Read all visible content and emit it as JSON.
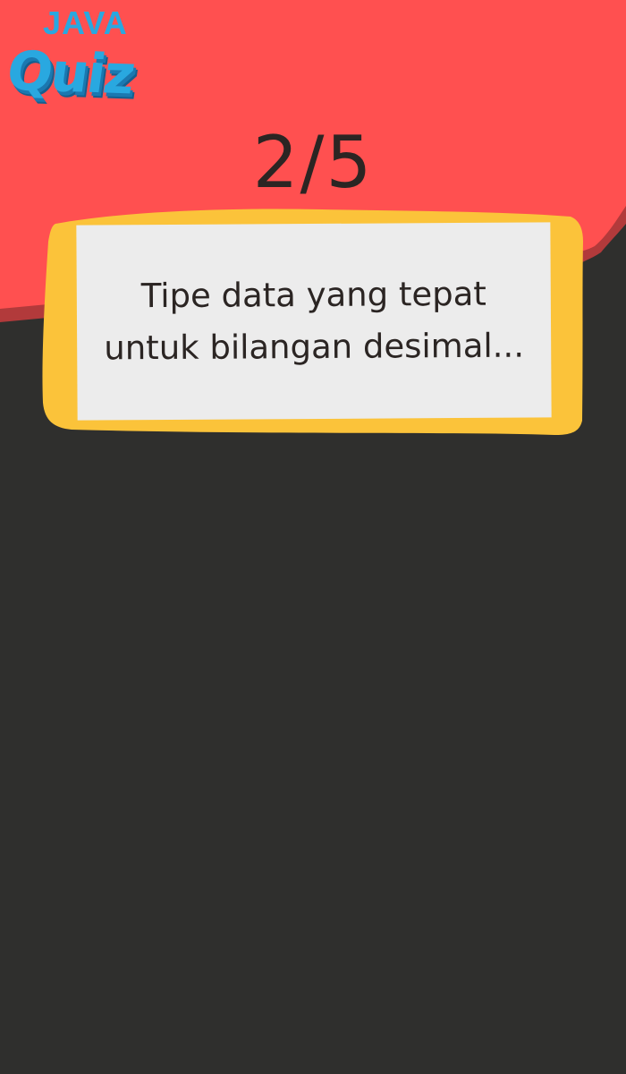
{
  "app": {
    "logo_top": "JAVA",
    "logo_bottom": "Quiz"
  },
  "progress": {
    "text": "2/5",
    "current": 2,
    "total": 5
  },
  "question": {
    "text": "Tipe data yang tepat untuk bilangan desimal..."
  },
  "colors": {
    "header_red": "#ff5050",
    "header_shadow": "#b23a3b",
    "body_dark": "#2f2f2d",
    "card_border": "#fbc33a",
    "card_fill": "#ececec",
    "text_dark": "#2b2523",
    "logo_blue": "#29a8e0"
  }
}
